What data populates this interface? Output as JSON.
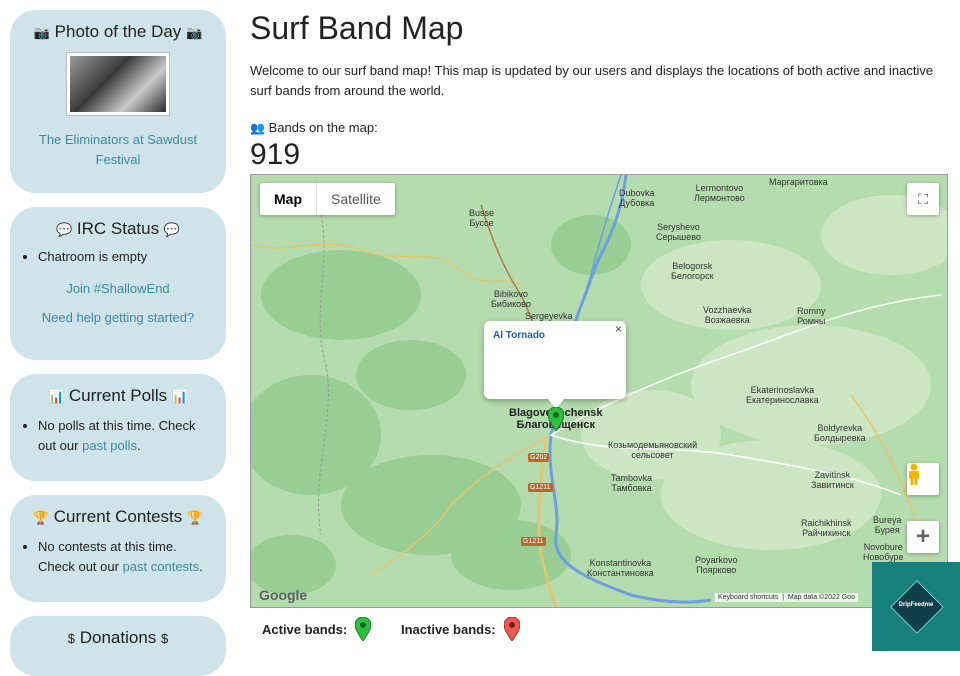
{
  "sidebar": {
    "photo": {
      "title": "Photo of the Day",
      "icon": "camera-icon",
      "caption": "The Eliminators at Sawdust Festival"
    },
    "irc": {
      "title": "IRC Status",
      "icon": "chat-bubble-icon",
      "status": "Chatroom is empty",
      "join_link": "Join #ShallowEnd",
      "help_link": "Need help getting started?"
    },
    "polls": {
      "title": "Current Polls",
      "icon": "bar-chart-icon",
      "text": "No polls at this time. Check out our",
      "link": "past polls",
      "suffix": "."
    },
    "contests": {
      "title": "Current Contests",
      "icon": "trophy-icon",
      "text": "No contests at this time. Check out our",
      "link": "past contests",
      "suffix": "."
    },
    "donations": {
      "title": "Donations",
      "icon": "dollar-icon"
    }
  },
  "main": {
    "title": "Surf Band Map",
    "intro": "Welcome to our surf band map! This map is updated by our users and displays the locations of both active and inactive surf bands from around the world.",
    "bands_label": "Bands on the map:",
    "bands_count": "919"
  },
  "map": {
    "type_map": "Map",
    "type_satellite": "Satellite",
    "infowindow_name": "Al Tornado",
    "close_glyph": "×",
    "zoom_in": "+",
    "google": "Google",
    "keyboard_shortcuts": "Keyboard shortcuts",
    "map_data": "Map data ©2022 Goo",
    "places": {
      "margaritovka": "Маргаритовка",
      "lermontovo": "Lermontovo\nЛермонтово",
      "dubovka": "Dubovka\nДубовка",
      "busse": "Busse\nБуссе",
      "seryshevo": "Seryshevo\nСерышево",
      "belogorsk": "Belogorsk\nБелогорск",
      "bibikovo": "Bibikovo\nБибиково",
      "sergeyevka": "Sergeyevka",
      "vozzhaevka": "Vozzhaevka\nВозжаевка",
      "romny": "Romny\nРомны",
      "blagoveshchensk": "Blagoveshchensk\nБлаговещенск",
      "ekaterinoslavka": "Ekaterinoslavka\nЕкатеринославка",
      "kozmodemyanovsky": "Козьмодемьяновский\nсельсовет",
      "boldyrevka": "Boldyrevka\nБолдыревка",
      "tambovka": "Tambovka\nТамбовка",
      "zavitinsk": "Zavitinsk\nЗавитинск",
      "raichikhinsk": "Raichikhinsk\nРайчихинск",
      "bureya": "Bureya\nБурея",
      "novobure": "Novobure\nНовобурe",
      "konstantinovka": "Konstantinovka\nКонстантиновка",
      "poyarkovo": "Poyarkovo\nПоярково"
    },
    "roads": [
      "G202",
      "G1211",
      "G1211"
    ]
  },
  "legend": {
    "active": "Active bands:",
    "inactive": "Inactive bands:",
    "active_color": "#2fbf3f",
    "inactive_color": "#ef5a4e"
  },
  "watermark": {
    "text": "DripFeedme"
  },
  "colors": {
    "sidebar_bg": "#cfe3ea",
    "link": "#3a8c9c",
    "map_land": "#a9d6a4",
    "river": "#5a8fd8"
  }
}
